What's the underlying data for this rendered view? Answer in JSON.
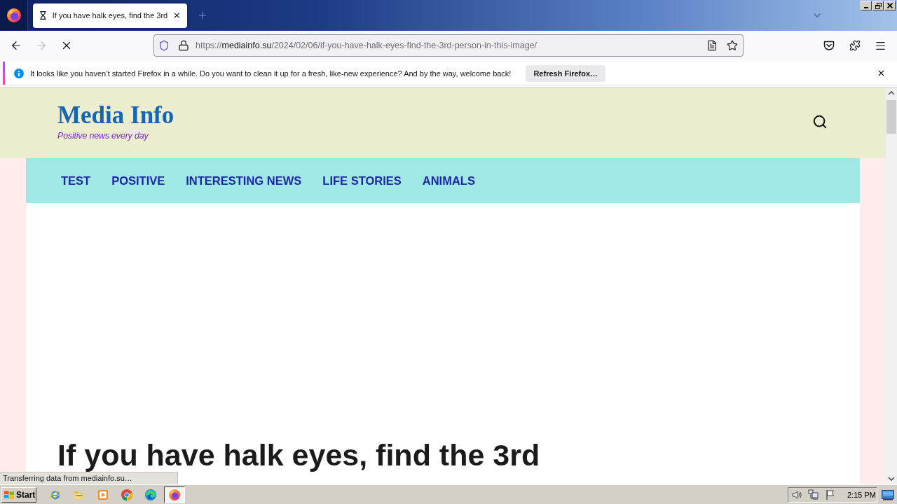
{
  "tab_strip": {
    "tabs": [
      {
        "title": "If you have halk eyes, find the 3rd",
        "selected": true,
        "loading": true
      }
    ]
  },
  "nav_buttons": [
    {
      "kind": "back",
      "disabled": false
    },
    {
      "kind": "forward",
      "disabled": true
    },
    {
      "kind": "stop",
      "disabled": false
    }
  ],
  "url": {
    "scheme": "https://",
    "host": "mediainfo.su",
    "path": "/2024/02/06/if-you-have-halk-eyes-find-the-3rd-person-in-this-image/"
  },
  "notification": {
    "message": "It looks like you haven’t started Firefox in a while. Do you want to clean it up for a fresh, like-new experience? And by the way, welcome back!",
    "button": "Refresh Firefox…"
  },
  "site": {
    "title": "Media Info",
    "tagline": "Positive news every day",
    "menu": [
      {
        "label": "TEST"
      },
      {
        "label": "POSITIVE"
      },
      {
        "label": "INTERESTING NEWS"
      },
      {
        "label": "LIFE STORIES"
      },
      {
        "label": "ANIMALS"
      }
    ]
  },
  "article": {
    "headline": "If you have halk eyes, find the 3rd"
  },
  "status_bar": {
    "text": "Transferring data from mediainfo.su…"
  },
  "taskbar": {
    "start": "Start",
    "apps": [
      {
        "kind": "ie",
        "selected": false
      },
      {
        "kind": "explorer",
        "selected": false
      },
      {
        "kind": "media",
        "selected": false
      },
      {
        "kind": "chrome",
        "selected": false
      },
      {
        "kind": "edge",
        "selected": false
      },
      {
        "kind": "firefox",
        "selected": true
      }
    ],
    "clock": "2:15 PM"
  }
}
